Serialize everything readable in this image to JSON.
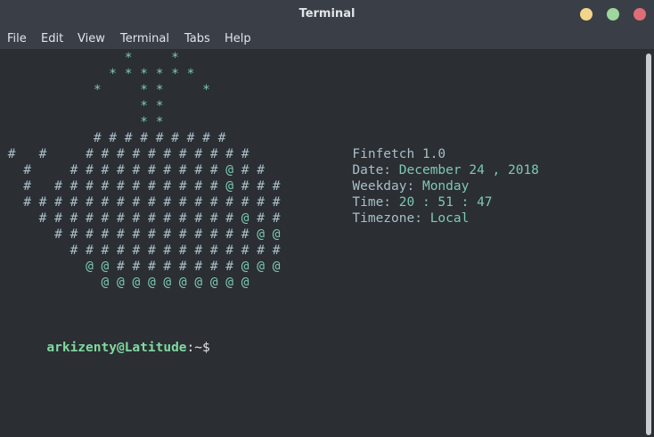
{
  "window": {
    "title": "Terminal",
    "controls": [
      "minimize",
      "maximize",
      "close"
    ]
  },
  "menu": [
    "File",
    "Edit",
    "View",
    "Terminal",
    "Tabs",
    "Help"
  ],
  "art": [
    "                *     *",
    "              * * * * * *",
    "            *     * *     *",
    "                  * *",
    "                  * *",
    "            # # # # # # # # #",
    " #   #     # # # # # # # # # # #",
    "   #     # # # # # # # # # # @ # #",
    "   #   # # # # # # # # # # # @ # # #",
    "   # # # # # # # # # # # # # # # # #",
    "     # # # # # # # # # # # # # @ # #",
    "       # # # # # # # # # # # # # @ @",
    "         # # # # # # # # # # # # # #",
    "           @ @ # # # # # # # # @ @ @",
    "             @ @ @ @ @ @ @ @ @ @"
  ],
  "info": {
    "name": "Finfetch 1.0",
    "date_label": "Date:",
    "date_value": "December 24 , 2018",
    "weekday_label": "Weekday:",
    "weekday_value": "Monday",
    "time_label": "Time:",
    "time_value": "20 : 51 : 47",
    "timezone_label": "Timezone:",
    "timezone_value": "Local"
  },
  "prompt": {
    "user_host": "arkizenty@Latitude",
    "path": ":~$"
  },
  "colors": {
    "background": "#2b2e33",
    "titlebar": "#3a3f47",
    "art": "#a9bfc8",
    "accent": "#7ec8b8",
    "prompt_user": "#7fd9a0"
  }
}
